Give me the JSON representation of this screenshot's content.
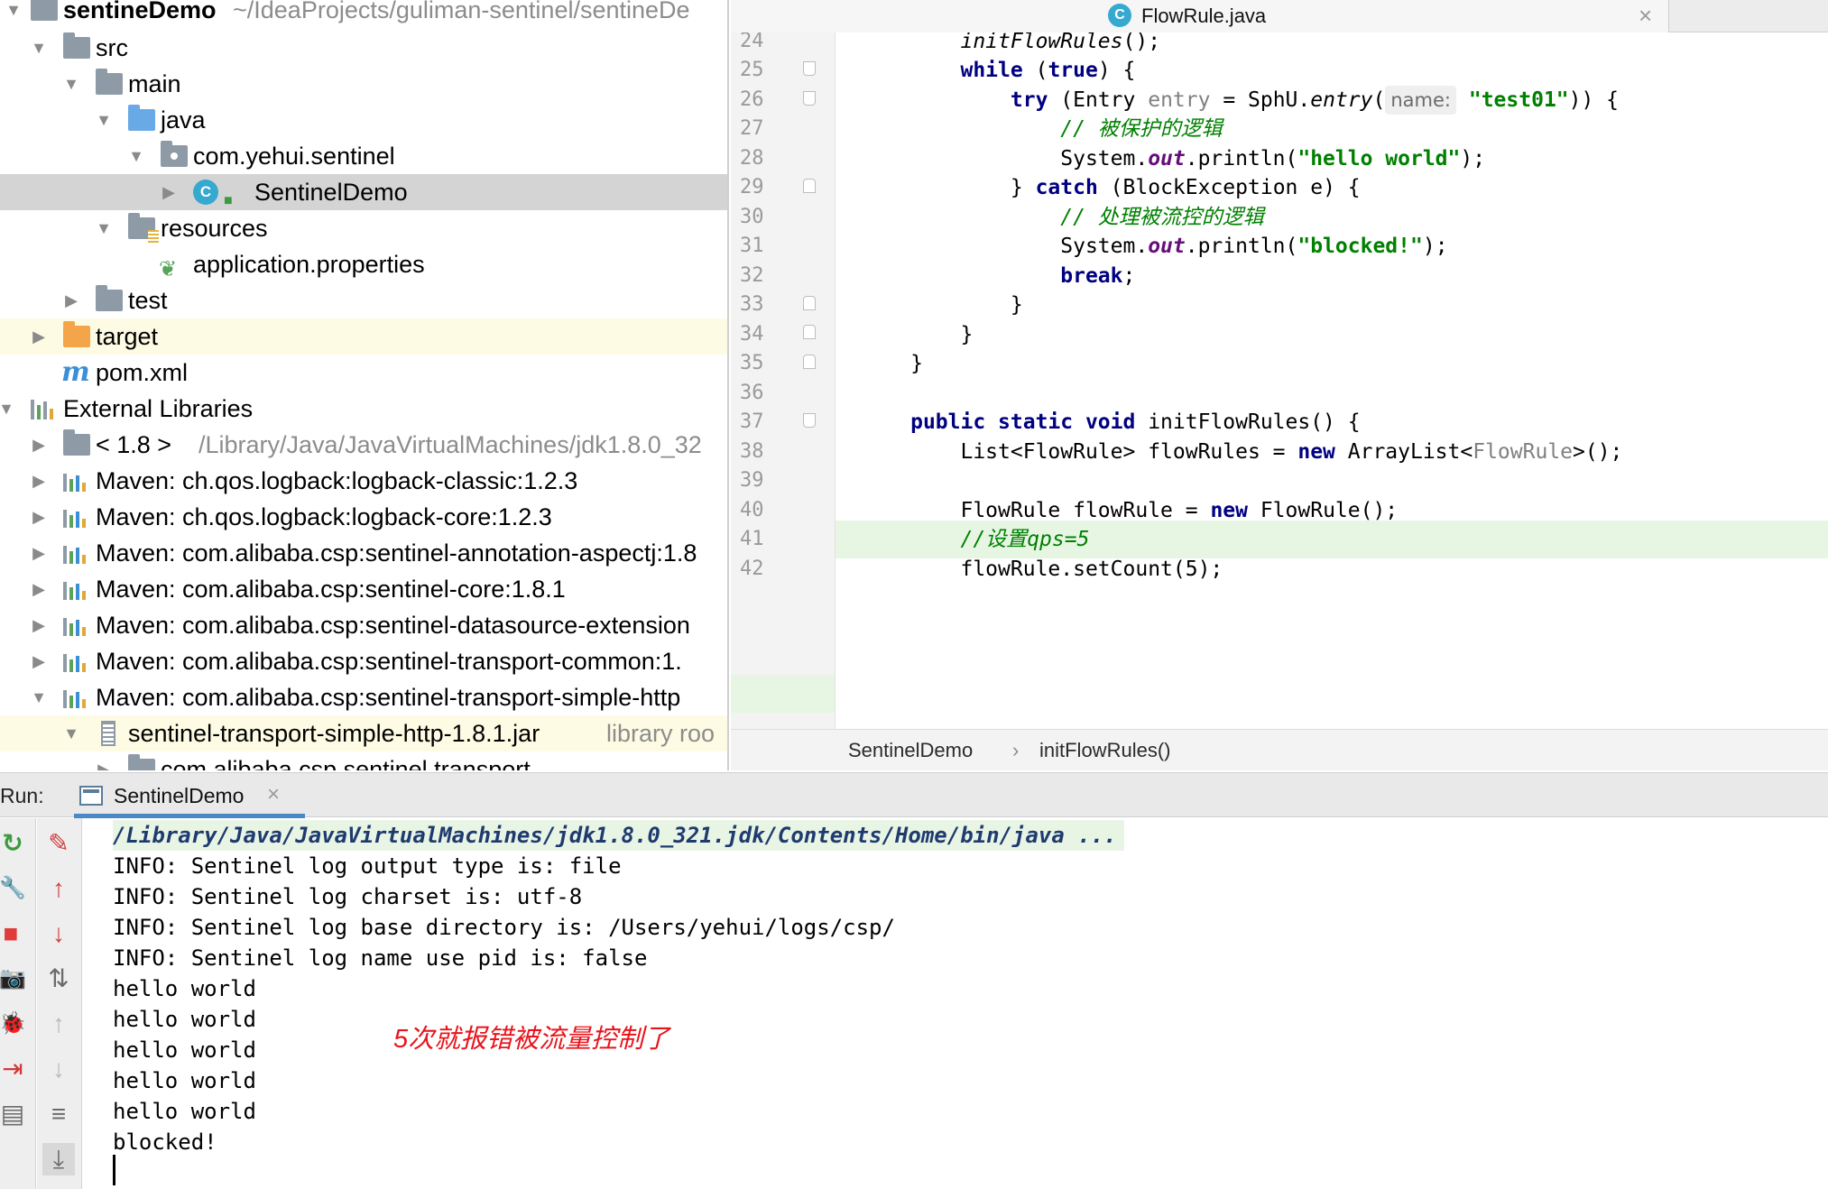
{
  "project_tree": {
    "root": {
      "name": "sentineDemo",
      "path": "~/IdeaProjects/guliman-sentinel/sentineDe"
    },
    "src": "src",
    "main": "main",
    "java": "java",
    "package": "com.yehui.sentinel",
    "class": "SentinelDemo",
    "resources": "resources",
    "properties_file": "application.properties",
    "test": "test",
    "target": "target",
    "pom": "pom.xml",
    "pom_icon_letter": "m",
    "external_libraries": "External Libraries",
    "jdk": {
      "name": "< 1.8 >",
      "path": "/Library/Java/JavaVirtualMachines/jdk1.8.0_32"
    },
    "libraries": [
      "Maven: ch.qos.logback:logback-classic:1.2.3",
      "Maven: ch.qos.logback:logback-core:1.2.3",
      "Maven: com.alibaba.csp:sentinel-annotation-aspectj:1.8",
      "Maven: com.alibaba.csp:sentinel-core:1.8.1",
      "Maven: com.alibaba.csp:sentinel-datasource-extension",
      "Maven: com.alibaba.csp:sentinel-transport-common:1.",
      "Maven: com.alibaba.csp:sentinel-transport-simple-http"
    ],
    "jar": {
      "name": "sentinel-transport-simple-http-1.8.1.jar",
      "suffix": "library roo"
    },
    "jar_package": "com.alibaba.csp.sentinel.transport"
  },
  "editor": {
    "tab_title": "FlowRule.java",
    "tab_icon_letter": "C",
    "close_glyph": "×",
    "line_numbers": [
      "24",
      "25",
      "26",
      "27",
      "28",
      "29",
      "30",
      "31",
      "32",
      "33",
      "34",
      "35",
      "36",
      "37",
      "38",
      "39",
      "40",
      "41",
      "42"
    ],
    "tokens": {
      "l24": "initFlowRules",
      "l24b": "();",
      "kw_while": "while",
      "kw_true": "true",
      "kw_try": "try",
      "kw_catch": "catch",
      "kw_break": "break",
      "kw_public": "public static void",
      "kw_new": "new",
      "p_open": " (",
      "p_close_brace": ") {",
      "entry_type": "(Entry ",
      "entry_var": "entry",
      "eq_sphu": " = SphU.",
      "entry_method": "entry",
      "paren_open": "(",
      "hint_name": "name:",
      "str_test01": "\"test01\"",
      "close_try": ")) {",
      "cmt_protected": "// 被保护的逻辑",
      "sysout": "System.",
      "out": "out",
      "println": ".println(",
      "str_hello": "\"hello world\"",
      "end_stmt": ");",
      "catch_open": "} ",
      "catch_rest": " (BlockException e) {",
      "cmt_limited": "// 处理被流控的逻辑",
      "str_blocked": "\"blocked!\"",
      "semicolon": ";",
      "brace_close": "}",
      "init_sig": " initFlowRules() {",
      "list_decl": "List<FlowRule> flowRules = ",
      "arraylist": " ArrayList<",
      "flowrule_generic": "FlowRule",
      "arraylist_end": ">();",
      "flowrule_decl": "FlowRule flowRule = ",
      "flowrule_ctor": " FlowRule();",
      "cmt_qps_prefix": "//设置",
      "cmt_qps_value": "qps=5",
      "l42": "flowRule.setCount(5);"
    }
  },
  "breadcrumb": {
    "class": "SentinelDemo",
    "separator": "›",
    "method": "initFlowRules()"
  },
  "run_panel": {
    "label": "Run:",
    "tab_title": "SentinelDemo",
    "tab_close": "×",
    "console_lines": [
      "/Library/Java/JavaVirtualMachines/jdk1.8.0_321.jdk/Contents/Home/bin/java ...",
      "INFO: Sentinel log output type is: file",
      "INFO: Sentinel log charset is: utf-8",
      "INFO: Sentinel log base directory is: /Users/yehui/logs/csp/",
      "INFO: Sentinel log name use pid is: false",
      "hello world",
      "hello world",
      "hello world",
      "hello world",
      "hello world",
      "blocked!"
    ],
    "annotation": "5次就报错被流量控制了"
  },
  "icons": {
    "expand": "▶",
    "collapse": "▼",
    "rerun": "↻",
    "wrench": "🔧",
    "stop": "■",
    "camera": "📷",
    "bug": "🐞",
    "exit": "⇥",
    "layout": "▤",
    "clear": "✎",
    "up": "↑",
    "down": "↓",
    "sort": "⇅",
    "wrap": "≡",
    "scroll_end": "⤓"
  },
  "colors": {
    "keyword": "#000080",
    "string": "#008000",
    "current_line": "#e6f6e3",
    "annotation": "#e8141c",
    "tab_underline": "#4a88c7"
  }
}
